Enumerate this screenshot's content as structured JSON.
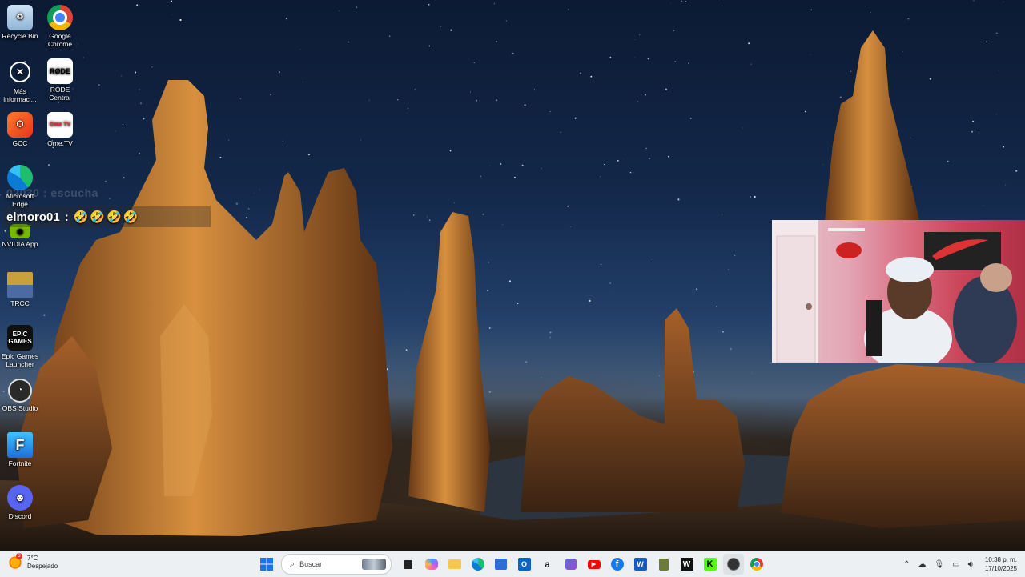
{
  "desktop_icons": [
    {
      "label": "Recycle Bin",
      "icon": "recycle-bin-icon"
    },
    {
      "label": "Google Chrome",
      "icon": "chrome-icon"
    },
    {
      "label": "Más informaci...",
      "icon": "info-icon"
    },
    {
      "label": "RODE Central",
      "icon": "rode-icon",
      "glyph": "RØDE"
    },
    {
      "label": "GCC",
      "icon": "gcc-icon"
    },
    {
      "label": "Ome.TV",
      "icon": "ometv-icon",
      "glyph": "Ome TV"
    },
    {
      "label": "Microsoft Edge",
      "icon": "edge-icon"
    },
    {
      "label": "NVIDIA App",
      "icon": "nvidia-icon"
    },
    {
      "label": "TRCC",
      "icon": "trcc-icon"
    },
    {
      "label": "Epic Games Launcher",
      "icon": "epic-games-icon",
      "glyph": "EPIC GAMES"
    },
    {
      "label": "OBS Studio",
      "icon": "obs-icon"
    },
    {
      "label": "Fortnite",
      "icon": "fortnite-icon",
      "glyph": "F"
    },
    {
      "label": "Discord",
      "icon": "discord-icon"
    }
  ],
  "chat": {
    "faded_message": "02030 : escucha",
    "username": "elmoro01",
    "separator": ":",
    "emojis": "🤣🤣🤣🤣"
  },
  "taskbar": {
    "weather_temp": "7°C",
    "weather_desc": "Despejado",
    "weather_badge": "3",
    "search_placeholder": "Buscar",
    "apps": [
      "windows-start-icon",
      "task-view-icon",
      "copilot-icon",
      "file-explorer-icon",
      "edge-icon",
      "store-icon",
      "outlook-icon",
      "amazon-icon",
      "app-icon",
      "youtube-icon",
      "facebook-icon",
      "word-icon",
      "clipboard-icon",
      "w-app-icon",
      "kick-icon",
      "obs-icon",
      "chrome-icon"
    ],
    "time": "10:38 p. m.",
    "date": "17/10/2025"
  },
  "colors": {
    "taskbar_bg": "#ecf0f3",
    "sky_top": "#0c1a33",
    "rock": "#c7762f",
    "webcam_red": "#d8445a"
  }
}
